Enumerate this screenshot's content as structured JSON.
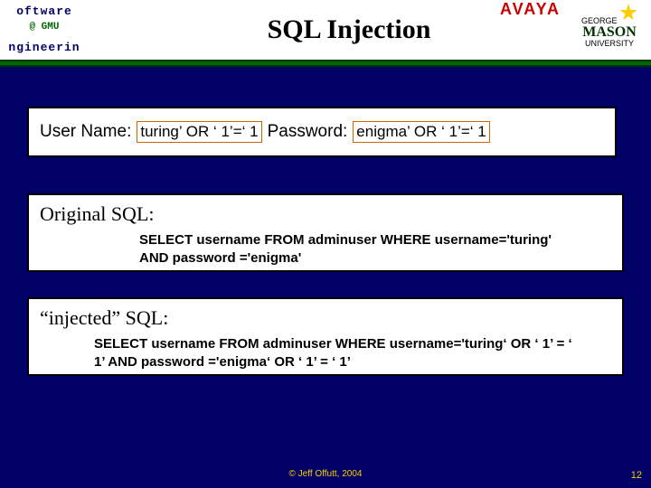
{
  "header": {
    "title": "SQL Injection",
    "logo_left_top": "oftware",
    "logo_left_mid": "@ GMU",
    "logo_left_bot": "ngineerin",
    "avaya": "AVAYA",
    "gmu_top": "GEORGE",
    "gmu_mid": "MASON",
    "gmu_bot": "UNIVERSITY"
  },
  "inputs": {
    "username_label": "User Name:",
    "username_value": "turing’ OR ‘ 1’=‘ 1",
    "password_label": "Password:",
    "password_value": "enigma’ OR ‘ 1’=‘ 1"
  },
  "original": {
    "label": "Original SQL:",
    "code": "SELECT username FROM adminuser WHERE username='turing' AND password ='enigma'"
  },
  "injected": {
    "label": "“injected” SQL:",
    "code": "SELECT username FROM adminuser WHERE username='turing‘ OR ‘ 1’ = ‘ 1’ AND password ='enigma‘ OR ‘ 1’ = ‘ 1’"
  },
  "footer": {
    "copyright": "© Jeff Offutt, 2004",
    "slide_number": "12"
  }
}
